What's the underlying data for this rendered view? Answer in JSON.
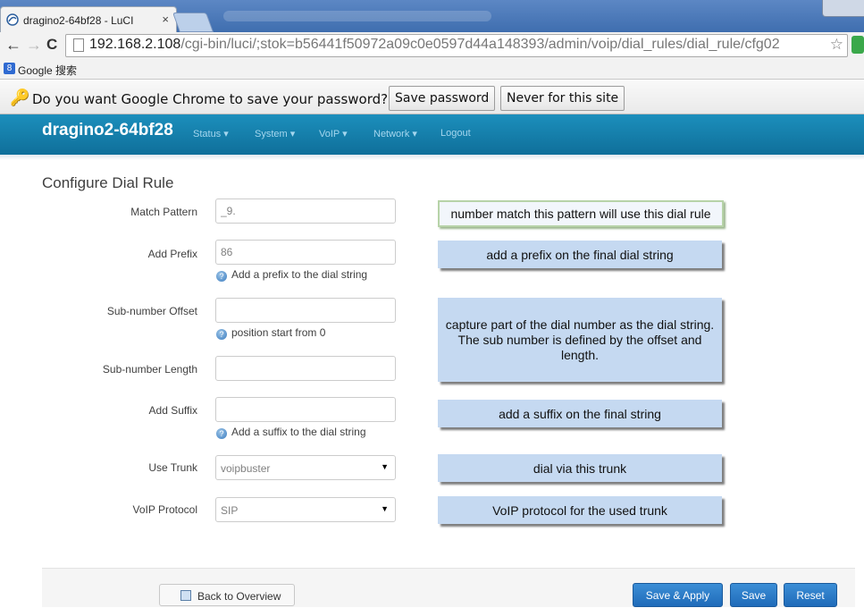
{
  "browser": {
    "tab_title": "dragino2-64bf28 - LuCI",
    "tab_close": "×",
    "url_host": "192.168.2.108",
    "url_path": "/cgi-bin/luci/;stok=b56441f50972a09c0e0597d44a148393/admin/voip/dial_rules/dial_rule/cfg02",
    "bookmark_label": "Google 搜索",
    "password_prompt": "Do you want Google Chrome to save your password?",
    "save_password_label": "Save password",
    "never_label": "Never for this site"
  },
  "header": {
    "brand": "dragino2-64bf28",
    "menu": [
      "Status ▾",
      "System ▾",
      "VoIP ▾",
      "Network ▾",
      "Logout"
    ]
  },
  "form": {
    "title": "Configure Dial Rule",
    "match_pattern": {
      "label": "Match Pattern",
      "value": "_9."
    },
    "add_prefix": {
      "label": "Add Prefix",
      "value": "86",
      "hint": "Add a prefix to the dial string"
    },
    "sub_offset": {
      "label": "Sub-number Offset",
      "value": "",
      "hint": "position start from 0"
    },
    "sub_length": {
      "label": "Sub-number Length",
      "value": ""
    },
    "add_suffix": {
      "label": "Add Suffix",
      "value": "",
      "hint": "Add a suffix to the dial string"
    },
    "use_trunk": {
      "label": "Use Trunk",
      "value": "voipbuster"
    },
    "voip_protocol": {
      "label": "VoIP Protocol",
      "value": "SIP"
    }
  },
  "notes": {
    "match": "number match this pattern will use this dial rule",
    "prefix": "add a prefix on the final dial string",
    "subnumber": "capture part of the dial number as the dial string. The sub number is defined by the offset and length.",
    "suffix": "add a suffix on the final string",
    "trunk": "dial via this trunk",
    "protocol": "VoIP protocol for the used trunk"
  },
  "actions": {
    "back": "Back to Overview",
    "save_apply": "Save & Apply",
    "save": "Save",
    "reset": "Reset"
  },
  "colors": {
    "header_bar": "#1c8fbc",
    "primary_button": "#2a7cc7",
    "note_fill": "#c5d9f1"
  }
}
